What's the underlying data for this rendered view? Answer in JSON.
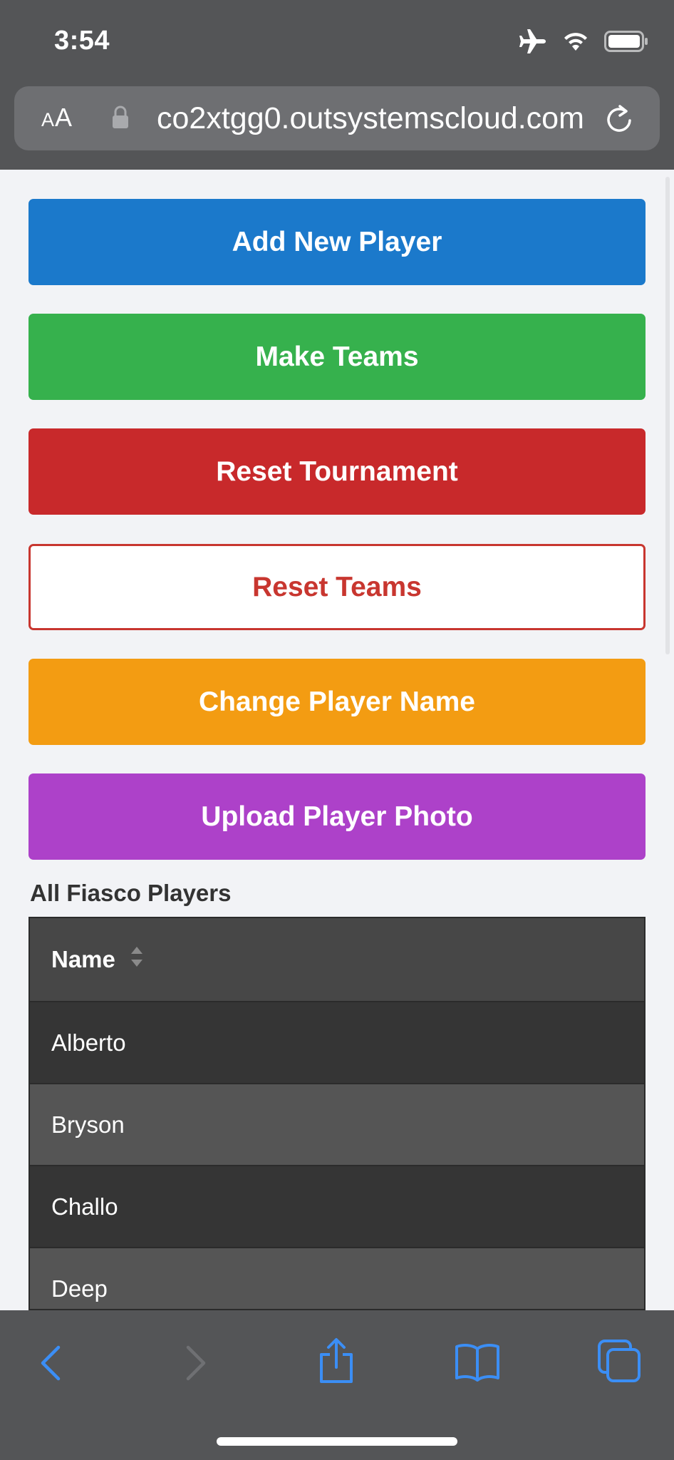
{
  "status_bar": {
    "time": "3:54",
    "icons": [
      "airplane-icon",
      "wifi-icon",
      "battery-icon"
    ]
  },
  "browser": {
    "text_size_label": "AA",
    "url": "co2xtgg0.outsystemscloud.com",
    "icons": [
      "lock-icon",
      "reload-icon"
    ]
  },
  "buttons": {
    "add_player": "Add New Player",
    "make_teams": "Make Teams",
    "reset_tournament": "Reset Tournament",
    "reset_teams": "Reset Teams",
    "change_name": "Change Player Name",
    "upload_photo": "Upload Player Photo"
  },
  "colors": {
    "blue": "#1b79cb",
    "green": "#36b14d",
    "red": "#c8292b",
    "orange": "#f39c12",
    "purple": "#ad41c9"
  },
  "players_table": {
    "title": "All Fiasco Players",
    "column_header": "Name",
    "rows": [
      "Alberto",
      "Bryson",
      "Challo",
      "Deep"
    ]
  },
  "toolbar": {
    "icons": [
      "back-icon",
      "forward-icon",
      "share-icon",
      "bookmarks-icon",
      "tabs-icon"
    ]
  }
}
